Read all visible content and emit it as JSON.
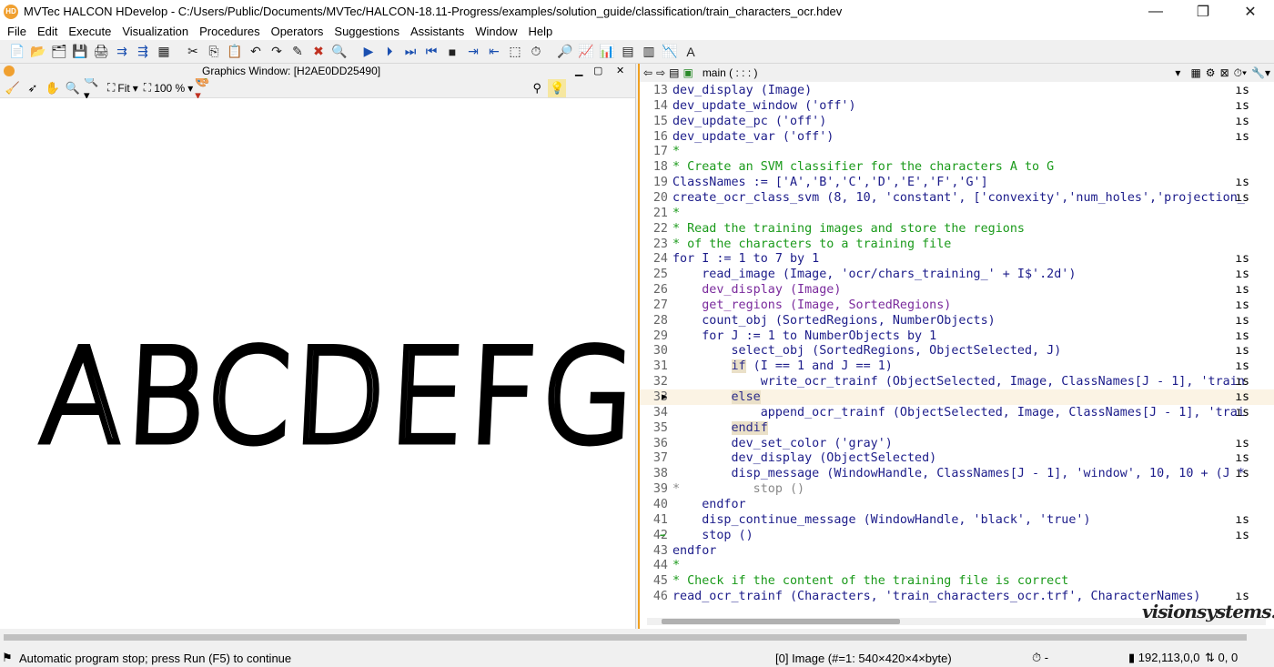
{
  "window": {
    "title": "MVTec HALCON HDevelop - C:/Users/Public/Documents/MVTec/HALCON-18.11-Progress/examples/solution_guide/classification/train_characters_ocr.hdev",
    "app_icon_text": "HD",
    "minimize": "—",
    "maximize": "❐",
    "close": "✕"
  },
  "menu": [
    "File",
    "Edit",
    "Execute",
    "Visualization",
    "Procedures",
    "Operators",
    "Suggestions",
    "Assistants",
    "Window",
    "Help"
  ],
  "graphics_window": {
    "title": "Graphics Window: [H2AE0DD25490]",
    "zoom_mode": "Fit",
    "zoom_percent": "100 %",
    "image_text": "ABCDEFG"
  },
  "program_window": {
    "procedure": "main ( : : : )"
  },
  "code_lines": [
    {
      "n": "13",
      "parts": [
        [
          "kw",
          "dev_display (Image)"
        ]
      ],
      "tail": "ıs"
    },
    {
      "n": "14",
      "parts": [
        [
          "kw",
          "dev_update_window ('off')"
        ]
      ],
      "tail": "ıs"
    },
    {
      "n": "15",
      "parts": [
        [
          "kw",
          "dev_update_pc ('off')"
        ]
      ],
      "tail": "ıs"
    },
    {
      "n": "16",
      "parts": [
        [
          "kw",
          "dev_update_var ('off')"
        ]
      ],
      "tail": "ıs"
    },
    {
      "n": "17",
      "parts": [
        [
          "cm",
          "*"
        ]
      ],
      "tail": ""
    },
    {
      "n": "18",
      "parts": [
        [
          "cm",
          "* Create an SVM classifier for the characters A to G"
        ]
      ],
      "tail": ""
    },
    {
      "n": "19",
      "parts": [
        [
          "kw",
          "ClassNames := ['A','B','C','D','E','F','G']"
        ]
      ],
      "tail": "ıs"
    },
    {
      "n": "20",
      "parts": [
        [
          "kw",
          "create_ocr_class_svm (8, 10, 'constant', ['convexity','num_holes','projection_"
        ]
      ],
      "tail": "ıs"
    },
    {
      "n": "21",
      "parts": [
        [
          "cm",
          "*"
        ]
      ],
      "tail": ""
    },
    {
      "n": "22",
      "parts": [
        [
          "cm",
          "* Read the training images and store the regions"
        ]
      ],
      "tail": ""
    },
    {
      "n": "23",
      "parts": [
        [
          "cm",
          "* of the characters to a training file"
        ]
      ],
      "tail": ""
    },
    {
      "n": "24",
      "parts": [
        [
          "kw",
          "for I := 1 to 7 by 1"
        ]
      ],
      "tail": "ıs"
    },
    {
      "n": "25",
      "parts": [
        [
          "txt",
          "    "
        ],
        [
          "kw",
          "read_image (Image, 'ocr/chars_training_' + I$'.2d')"
        ]
      ],
      "tail": "ıs"
    },
    {
      "n": "26",
      "parts": [
        [
          "txt",
          "    "
        ],
        [
          "op",
          "dev_display (Image)"
        ]
      ],
      "tail": "ıs"
    },
    {
      "n": "27",
      "parts": [
        [
          "txt",
          "    "
        ],
        [
          "op",
          "get_regions (Image, SortedRegions)"
        ]
      ],
      "tail": "ıs"
    },
    {
      "n": "28",
      "parts": [
        [
          "txt",
          "    "
        ],
        [
          "kw",
          "count_obj (SortedRegions, NumberObjects)"
        ]
      ],
      "tail": "ıs"
    },
    {
      "n": "29",
      "parts": [
        [
          "txt",
          "    "
        ],
        [
          "kw",
          "for J := 1 to NumberObjects by 1"
        ]
      ],
      "tail": "ıs"
    },
    {
      "n": "30",
      "parts": [
        [
          "txt",
          "        "
        ],
        [
          "kw",
          "select_obj (SortedRegions, ObjectSelected, J)"
        ]
      ],
      "tail": "ıs"
    },
    {
      "n": "31",
      "parts": [
        [
          "txt",
          "        "
        ],
        [
          "flow",
          "if"
        ],
        [
          "kw",
          " (I == 1 and J == 1)"
        ]
      ],
      "tail": "ıs"
    },
    {
      "n": "32",
      "parts": [
        [
          "txt",
          "            "
        ],
        [
          "kw",
          "write_ocr_trainf (ObjectSelected, Image, ClassNames[J - 1], 'train"
        ]
      ],
      "tail": "ıs"
    },
    {
      "n": "33",
      "parts": [
        [
          "txt",
          "        "
        ],
        [
          "flow",
          "else"
        ]
      ],
      "tail": "ıs",
      "current": true
    },
    {
      "n": "34",
      "parts": [
        [
          "txt",
          "            "
        ],
        [
          "kw",
          "append_ocr_trainf (ObjectSelected, Image, ClassNames[J - 1], 'trai"
        ]
      ],
      "tail": "ıs"
    },
    {
      "n": "35",
      "parts": [
        [
          "txt",
          "        "
        ],
        [
          "flow",
          "endif"
        ]
      ],
      "tail": ""
    },
    {
      "n": "36",
      "parts": [
        [
          "txt",
          "        "
        ],
        [
          "kw",
          "dev_set_color ('gray')"
        ]
      ],
      "tail": "ıs"
    },
    {
      "n": "37",
      "parts": [
        [
          "txt",
          "        "
        ],
        [
          "kw",
          "dev_display (ObjectSelected)"
        ]
      ],
      "tail": "ıs"
    },
    {
      "n": "38",
      "parts": [
        [
          "txt",
          "        "
        ],
        [
          "kw",
          "disp_message (WindowHandle, ClassNames[J - 1], 'window', 10, 10 + (J *"
        ]
      ],
      "tail": "ıs"
    },
    {
      "n": "39",
      "parts": [
        [
          "txt",
          "*"
        ],
        [
          "txt",
          "          stop ()"
        ]
      ],
      "tail": "",
      "dim": true
    },
    {
      "n": "40",
      "parts": [
        [
          "txt",
          "    "
        ],
        [
          "kw",
          "endfor"
        ]
      ],
      "tail": ""
    },
    {
      "n": "41",
      "parts": [
        [
          "txt",
          "    "
        ],
        [
          "kw",
          "disp_continue_message (WindowHandle, 'black', 'true')"
        ]
      ],
      "tail": "ıs"
    },
    {
      "n": "42",
      "parts": [
        [
          "txt",
          "    "
        ],
        [
          "kw",
          "stop ()"
        ]
      ],
      "tail": "ıs",
      "pc": true
    },
    {
      "n": "43",
      "parts": [
        [
          "kw",
          "endfor"
        ]
      ],
      "tail": ""
    },
    {
      "n": "44",
      "parts": [
        [
          "cm",
          "*"
        ]
      ],
      "tail": ""
    },
    {
      "n": "45",
      "parts": [
        [
          "cm",
          "* Check if the content of the training file is correct"
        ]
      ],
      "tail": ""
    },
    {
      "n": "46",
      "parts": [
        [
          "kw",
          "read_ocr_trainf (Characters, 'train_characters_ocr.trf', CharacterNames)"
        ]
      ],
      "tail": "ıs"
    }
  ],
  "watermark": "visionsystems.ir",
  "status": {
    "message": "Automatic program stop; press Run (F5) to continue",
    "image_info": "[0] Image (#=1: 540×420×4×byte)",
    "timer": "⏱ -",
    "pixel": "▮ 192,113,0,0",
    "coords": "⇅ 0, 0"
  }
}
